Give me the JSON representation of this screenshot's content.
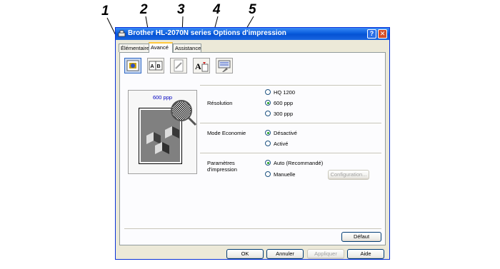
{
  "callouts": [
    "1",
    "2",
    "3",
    "4",
    "5"
  ],
  "window": {
    "title": "Brother HL-2070N series Options d'impression",
    "help_glyph": "?",
    "close_glyph": "✕"
  },
  "tabs": [
    {
      "label": "Élémentaire",
      "active": false
    },
    {
      "label": "Avancé",
      "active": true
    },
    {
      "label": "Assistance",
      "active": false
    }
  ],
  "toolbar_icons": [
    {
      "name": "print-quality-icon",
      "selected": true
    },
    {
      "name": "duplex-icon",
      "selected": false
    },
    {
      "name": "watermark-icon",
      "selected": false
    },
    {
      "name": "page-setting-icon",
      "selected": false
    },
    {
      "name": "device-options-icon",
      "selected": false
    }
  ],
  "preview": {
    "resolution_label": "600 ppp"
  },
  "resolution": {
    "label": "Résolution",
    "options": [
      {
        "label": "HQ 1200",
        "selected": false
      },
      {
        "label": "600 ppp",
        "selected": true
      },
      {
        "label": "300 ppp",
        "selected": false
      }
    ]
  },
  "economy": {
    "label": "Mode Economie",
    "options": [
      {
        "label": "Désactivé",
        "selected": true
      },
      {
        "label": "Activé",
        "selected": false
      }
    ]
  },
  "print_settings": {
    "label_line1": "Paramètres",
    "label_line2": "d'impression",
    "options": [
      {
        "label": "Auto (Recommandé)",
        "selected": true
      },
      {
        "label": "Manuelle",
        "selected": false
      }
    ],
    "config_button": "Configuration..."
  },
  "buttons": {
    "default": "Défaut",
    "ok": "OK",
    "cancel": "Annuler",
    "apply": "Appliquer",
    "help": "Aide"
  }
}
